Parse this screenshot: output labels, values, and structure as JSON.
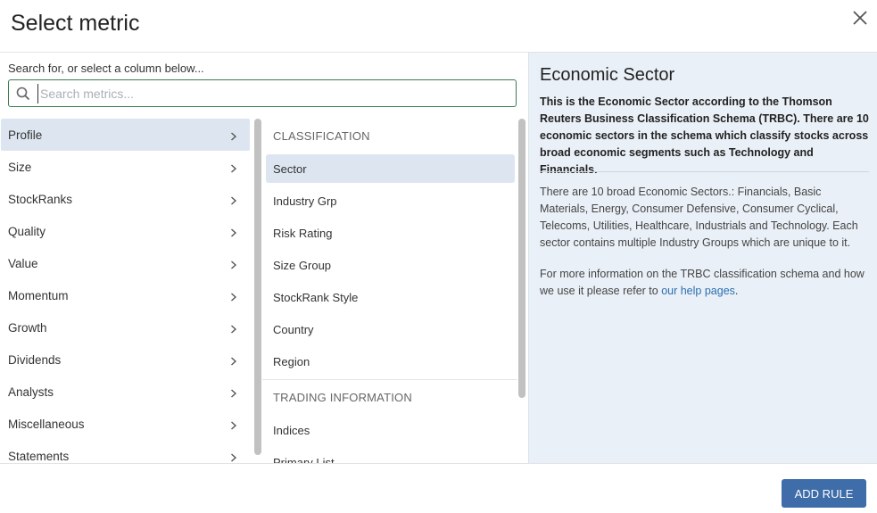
{
  "dialog": {
    "title": "Select metric",
    "close_icon": "close-icon"
  },
  "search": {
    "label": "Search for, or select a column below...",
    "placeholder": "Search metrics...",
    "value": "",
    "icon": "search-icon"
  },
  "categories": [
    {
      "label": "Profile",
      "active": true
    },
    {
      "label": "Size",
      "active": false
    },
    {
      "label": "StockRanks",
      "active": false
    },
    {
      "label": "Quality",
      "active": false
    },
    {
      "label": "Value",
      "active": false
    },
    {
      "label": "Momentum",
      "active": false
    },
    {
      "label": "Growth",
      "active": false
    },
    {
      "label": "Dividends",
      "active": false
    },
    {
      "label": "Analysts",
      "active": false
    },
    {
      "label": "Miscellaneous",
      "active": false
    },
    {
      "label": "Statements",
      "active": false
    }
  ],
  "metrics": {
    "sections": [
      {
        "heading": "CLASSIFICATION",
        "items": [
          {
            "label": "Sector",
            "active": true
          },
          {
            "label": "Industry Grp",
            "active": false
          },
          {
            "label": "Risk Rating",
            "active": false
          },
          {
            "label": "Size Group",
            "active": false
          },
          {
            "label": "StockRank Style",
            "active": false
          },
          {
            "label": "Country",
            "active": false
          },
          {
            "label": "Region",
            "active": false
          }
        ]
      },
      {
        "heading": "TRADING INFORMATION",
        "items": [
          {
            "label": "Indices",
            "active": false
          },
          {
            "label": "Primary List",
            "active": false
          }
        ]
      }
    ]
  },
  "detail": {
    "title": "Economic Sector",
    "description": "This is the Economic Sector according to the Thomson Reuters Business Classification Schema (TRBC). There are 10 economic sectors in the schema which classify stocks across broad economic segments such as Technology and Financials.",
    "paragraph1": "There are 10 broad Economic Sectors.: Financials, Basic Materials, Energy, Consumer Defensive, Consumer Cyclical, Telecoms, Utilities, Healthcare, Industrials and Technology. Each sector contains multiple Industry Groups which are unique to it.",
    "paragraph2_prefix": "For more information on the TRBC classification schema and how we use it please refer to ",
    "paragraph2_link": "our help pages",
    "paragraph2_suffix": "."
  },
  "footer": {
    "add_rule_label": "ADD RULE"
  },
  "colors": {
    "accent": "#3e6da9",
    "selected_bg": "#dde6f0",
    "detail_bg": "#eaf0f7",
    "search_border": "#3c7a4e",
    "link": "#2a6fb0"
  }
}
